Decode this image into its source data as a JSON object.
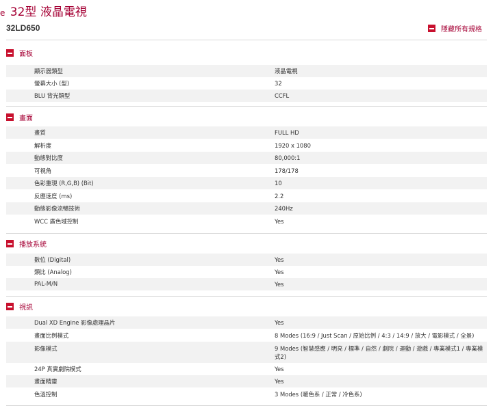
{
  "header": {
    "title": "32型 液晶電視",
    "title_mark": "e",
    "model": "32LD650",
    "hide_all_label": "隱藏所有規格"
  },
  "colors": {
    "accent": "#a50034",
    "icon_bg": "#c8102e",
    "stripe": "#f2f2f2",
    "rule": "#d8d8d8"
  },
  "sections": [
    {
      "title": "面板",
      "rows": [
        {
          "label": "顯示器類型",
          "value": "液晶電視"
        },
        {
          "label": "螢幕大小 (型)",
          "value": "32"
        },
        {
          "label": "BLU 背光類型",
          "value": "CCFL"
        }
      ]
    },
    {
      "title": "畫面",
      "rows": [
        {
          "label": "畫質",
          "value": "FULL HD"
        },
        {
          "label": "解析度",
          "value": "1920 x 1080"
        },
        {
          "label": "動態對比度",
          "value": "80,000:1"
        },
        {
          "label": "可視角",
          "value": "178/178"
        },
        {
          "label": "色彩重現 (R,G,B) (Bit)",
          "value": "10"
        },
        {
          "label": "反應速度 (ms)",
          "value": "2.2"
        },
        {
          "label": "動態影像流暢技術",
          "value": "240Hz"
        },
        {
          "label": "WCC 廣色域控制",
          "value": "Yes"
        }
      ]
    },
    {
      "title": "播放系統",
      "rows": [
        {
          "label": "數位 (Digital)",
          "value": "Yes"
        },
        {
          "label": "類比 (Analog)",
          "value": "Yes"
        },
        {
          "label": "PAL-M/N",
          "value": "Yes"
        }
      ]
    },
    {
      "title": "視訊",
      "rows": [
        {
          "label": "Dual XD Engine 影像處理晶片",
          "value": "Yes"
        },
        {
          "label": "畫面比例模式",
          "value": "8 Modes (16:9 / Just Scan / 原始比例 / 4:3 / 14:9 / 放大 / 電影模式 / 全景)"
        },
        {
          "label": "影像模式",
          "value": "9 Modes (智慧感應 / 明亮 / 標準 / 自然 / 劇院 / 運動 / 遊戲 / 專業模式1 / 專業模式2)"
        },
        {
          "label": "24P 真實劇院模式",
          "value": "Yes"
        },
        {
          "label": "畫面精靈",
          "value": "Yes"
        },
        {
          "label": "色溫控制",
          "value": "3 Modes (暖色系 / 正常 / 冷色系)"
        }
      ]
    }
  ]
}
